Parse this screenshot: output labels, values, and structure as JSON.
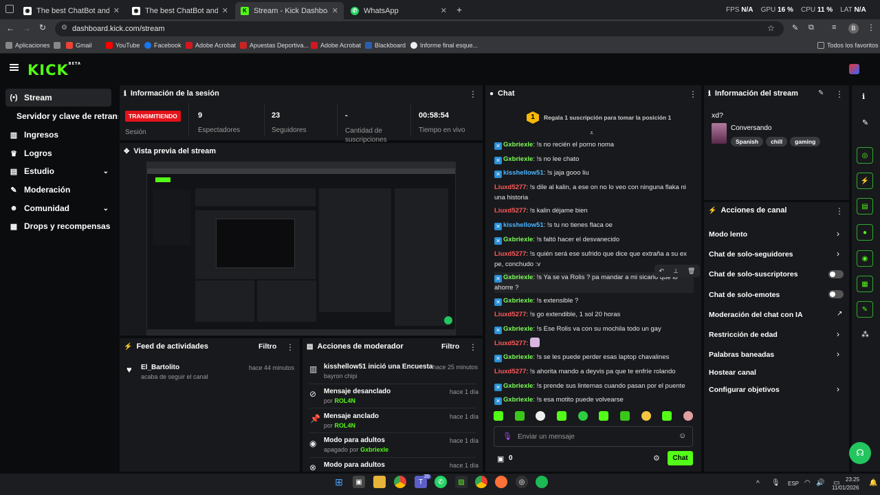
{
  "browser": {
    "tabs": [
      {
        "title": "The best ChatBot and Widgets"
      },
      {
        "title": "The best ChatBot and Widgets"
      },
      {
        "title": "Stream - Kick Dashboard"
      },
      {
        "title": "WhatsApp"
      }
    ],
    "perf": {
      "fps_label": "FPS",
      "fps_val": "N/A",
      "gpu_label": "GPU",
      "gpu_val": "16 %",
      "cpu_label": "CPU",
      "cpu_val": "11 %",
      "lat_label": "LAT",
      "lat_val": "N/A"
    },
    "url": "dashboard.kick.com/stream",
    "profile_initial": "B",
    "bookmarks": [
      "Aplicaciones",
      "Gmail",
      "YouTube",
      "Facebook",
      "Adobe Acrobat",
      "Apuestas Deportiva...",
      "Adobe Acrobat",
      "Blackboard",
      "Informe final esque..."
    ],
    "all_bookmarks": "Todos los favoritos"
  },
  "brand": {
    "logo": "KICK",
    "beta": "BETA",
    "accent": "#53fc18"
  },
  "sidebar": {
    "items": [
      {
        "label": "Stream"
      },
      {
        "label": "Servidor y clave de retransmisión"
      },
      {
        "label": "Ingresos"
      },
      {
        "label": "Logros"
      },
      {
        "label": "Estudio"
      },
      {
        "label": "Moderación"
      },
      {
        "label": "Comunidad"
      },
      {
        "label": "Drops y recompensas"
      }
    ]
  },
  "session": {
    "title": "Información de la sesión",
    "status_badge": "TRANSMITIENDO",
    "status_label": "Sesión",
    "stats": [
      {
        "value": "9",
        "label": "Espectadores"
      },
      {
        "value": "23",
        "label": "Seguidores"
      },
      {
        "value": "-",
        "label": "Cantidad de suscripciones"
      },
      {
        "value": "00:58:54",
        "label": "Tiempo en vivo"
      }
    ]
  },
  "preview": {
    "title": "Vista previa del stream"
  },
  "feed": {
    "title": "Feed de actividades",
    "filter": "Filtro",
    "items": [
      {
        "user": "El_Bartolito",
        "action": "acaba de seguir el canal",
        "time": "hace 44 minutos"
      }
    ]
  },
  "modactions": {
    "title": "Acciones de moderador",
    "filter": "Filtro",
    "items": [
      {
        "title": "kisshellow51 inició una Encuesta",
        "sub": "bayron chipi",
        "time": "hace 25 minutos",
        "user": ""
      },
      {
        "title": "Mensaje desanclado",
        "sub": "por",
        "user": "ROL4N",
        "time": "hace 1 día"
      },
      {
        "title": "Mensaje anclado",
        "sub": "por",
        "user": "ROL4N",
        "time": "hace 1 día"
      },
      {
        "title": "Modo para adultos",
        "sub": "apagado por",
        "user": "Gxbriexle",
        "time": "hace 1 día"
      },
      {
        "title": "Modo para adultos",
        "sub": "",
        "user": "",
        "time": "hace 1 día"
      }
    ]
  },
  "chat": {
    "title": "Chat",
    "gift_rank": "1",
    "gift_text": "Regala 1 suscripción para tomar la posición 1",
    "messages": [
      {
        "user": "Gxbriexle",
        "text": "!s no recién el porno noma",
        "color": "g",
        "badge": true
      },
      {
        "user": "Gxbriexle",
        "text": "!s no lee chato",
        "color": "g",
        "badge": true
      },
      {
        "user": "kisshellow51",
        "text": "!s jaja gooo liu",
        "color": "b",
        "badge": true
      },
      {
        "user": "Liuxd5277",
        "text": "!s dile al kalin, a ese on no lo veo con ninguna flaka ni una historia",
        "color": "r",
        "badge": false
      },
      {
        "user": "Liuxd5277",
        "text": "!s kalin déjame bien",
        "color": "r",
        "badge": false
      },
      {
        "user": "kisshellow51",
        "text": "!s tu no tienes flaca oe",
        "color": "b",
        "badge": true
      },
      {
        "user": "Gxbriexle",
        "text": "!s faltó hacer el desvanecido",
        "color": "g",
        "badge": true
      },
      {
        "user": "Liuxd5277",
        "text": "!s quién será ese sufrido que dice que extraña a su ex pe, conchudo :v",
        "color": "r",
        "badge": false
      },
      {
        "user": "Gxbriexle",
        "text": "!s Ya se va Rolis ? pa mandar a mi sicario que lo ahorre ?",
        "color": "g",
        "badge": true
      },
      {
        "user": "Gxbriexle",
        "text": "!s extensible ?",
        "color": "g",
        "badge": true
      },
      {
        "user": "Liuxd5277",
        "text": "!s go extendible, 1 sol 20 horas",
        "color": "r",
        "badge": false
      },
      {
        "user": "Gxbriexle",
        "text": "!s Ese Rolis va con su mochila todo un gay",
        "color": "g",
        "badge": true
      },
      {
        "user": "Liuxd5277",
        "text": "",
        "color": "r",
        "badge": false
      },
      {
        "user": "Gxbriexle",
        "text": "!s se les puede perder esas laptop chavalines",
        "color": "g",
        "badge": true
      },
      {
        "user": "Liuxd5277",
        "text": "!s ahorita mando a deyvis pa que te enfríe rolando",
        "color": "r",
        "badge": false
      },
      {
        "user": "Gxbriexle",
        "text": "!s prende sus linternas cuando pasan por el puente",
        "color": "g",
        "badge": true
      },
      {
        "user": "Gxbriexle",
        "text": "!s esa motito puede volvearse",
        "color": "g",
        "badge": true
      }
    ],
    "input_placeholder": "Enviar un mensaje",
    "points": "0",
    "send_label": "Chat"
  },
  "stream_info": {
    "title": "Información del stream",
    "stream_title": "xd?",
    "category": "Conversando",
    "tags": [
      "Spanish",
      "chill",
      "gaming"
    ]
  },
  "channel_actions": {
    "title": "Acciones de canal",
    "items": [
      {
        "label": "Modo lento",
        "control": "chevron"
      },
      {
        "label": "Chat de solo-seguidores",
        "control": "chevron"
      },
      {
        "label": "Chat de solo-suscriptores",
        "control": "toggle"
      },
      {
        "label": "Chat de solo-emotes",
        "control": "toggle"
      },
      {
        "label": "Moderación del chat con IA",
        "control": "external"
      },
      {
        "label": "Restricción de edad",
        "control": "chevron"
      },
      {
        "label": "Palabras baneadas",
        "control": "chevron"
      },
      {
        "label": "Hostear canal",
        "control": "none"
      },
      {
        "label": "Configurar objetivos",
        "control": "chevron"
      }
    ]
  },
  "taskbar": {
    "lang": "ESP",
    "time": "23:25",
    "date": "11/01/2026",
    "teams_badge": "20"
  }
}
